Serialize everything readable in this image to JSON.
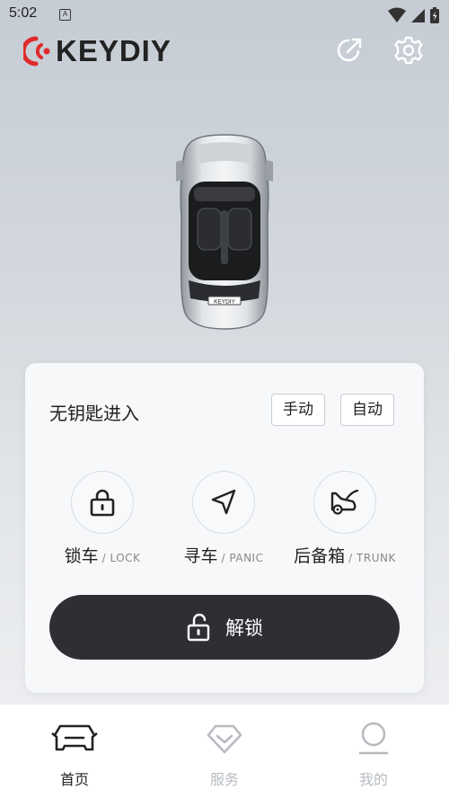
{
  "status_bar": {
    "time": "5:02",
    "notification_icon": "A"
  },
  "header": {
    "logo_text": "KEYDIY"
  },
  "car": {
    "plate_text": "KEYDIY"
  },
  "keyless_entry": {
    "label": "无钥匙进入",
    "manual_label": "手动",
    "auto_label": "自动"
  },
  "actions": [
    {
      "zh": "锁车",
      "en": "/ LOCK",
      "icon": "lock-icon"
    },
    {
      "zh": "寻车",
      "en": "/ PANIC",
      "icon": "locate-arrow-icon"
    },
    {
      "zh": "后备箱",
      "en": "/ TRUNK",
      "icon": "trunk-icon"
    }
  ],
  "unlock": {
    "label": "解锁"
  },
  "tabs": [
    {
      "label": "首页",
      "icon": "car-home-icon",
      "active": true
    },
    {
      "label": "服务",
      "icon": "diamond-icon",
      "active": false
    },
    {
      "label": "我的",
      "icon": "person-icon",
      "active": false
    }
  ],
  "colors": {
    "accent_red": "#e02b2b",
    "dark_button": "#2d2f33",
    "inactive_tab": "#b7bbc0"
  }
}
